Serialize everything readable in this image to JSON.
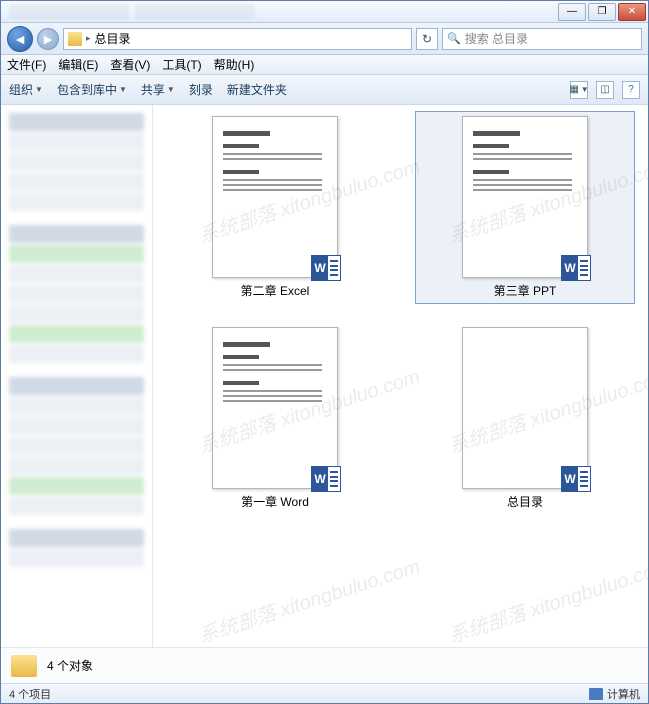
{
  "titlebar": {
    "close": "✕",
    "max": "❐",
    "min": "—"
  },
  "nav": {
    "folder": "总目录",
    "search_placeholder": "搜索 总目录"
  },
  "menu": {
    "file": "文件(F)",
    "edit": "编辑(E)",
    "view": "查看(V)",
    "tools": "工具(T)",
    "help": "帮助(H)"
  },
  "toolbar": {
    "organize": "组织",
    "include": "包含到库中",
    "share": "共享",
    "slideshow": "刻录",
    "newfolder": "新建文件夹"
  },
  "files": [
    {
      "label": "第二章 Excel",
      "preview_title": "第二章  Excel",
      "selected": false,
      "has_text": true
    },
    {
      "label": "第三章 PPT",
      "preview_title": "第三章  PPT",
      "selected": true,
      "has_text": true
    },
    {
      "label": "第一章 Word",
      "preview_title": "第一章  Word",
      "selected": false,
      "has_text": true
    },
    {
      "label": "总目录",
      "preview_title": "",
      "selected": false,
      "has_text": false
    }
  ],
  "details": {
    "count": "4 个对象"
  },
  "status": {
    "items": "4 个项目",
    "computer": "计算机"
  },
  "watermark": "系统部落 xitongbuluo.com"
}
